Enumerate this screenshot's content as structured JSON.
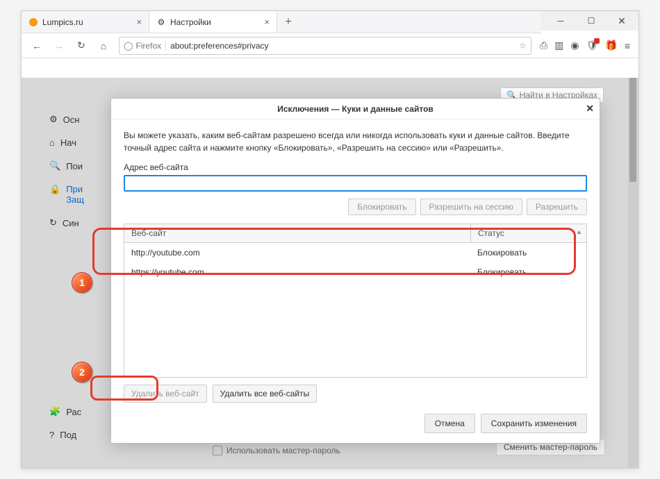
{
  "tabs": [
    {
      "favicon": "orange-circle",
      "label": "Lumpics.ru"
    },
    {
      "favicon": "gear",
      "label": "Настройки"
    }
  ],
  "urlbar": {
    "identity_label": "Firefox",
    "url": "about:preferences#privacy"
  },
  "sidebar": {
    "search_placeholder": "Найти в Настройках",
    "items": [
      {
        "icon": "gear",
        "label": "Осн"
      },
      {
        "icon": "home",
        "label": "Нач"
      },
      {
        "icon": "search",
        "label": "Пои"
      },
      {
        "icon": "lock",
        "label_line1": "При",
        "label_line2": "Защ"
      },
      {
        "icon": "sync",
        "label": "Син"
      }
    ],
    "bottom_items": [
      {
        "icon": "puzzle",
        "label": "Рас"
      },
      {
        "icon": "help",
        "label": "Под"
      }
    ]
  },
  "background_content": {
    "checkbox_label": "Использовать мастер-пароль",
    "master_pw_button": "Сменить мастер-пароль"
  },
  "modal": {
    "title": "Исключения — Куки и данные сайтов",
    "description": "Вы можете указать, каким веб-сайтам разрешено всегда или никогда использовать куки и данные сайтов. Введите точный адрес сайта и нажмите кнопку «Блокировать», «Разрешить на сессию» или «Разрешить».",
    "input_label": "Адрес веб-сайта",
    "input_value": "",
    "buttons": {
      "block": "Блокировать",
      "allow_session": "Разрешить на сессию",
      "allow": "Разрешить"
    },
    "table": {
      "col_site": "Веб-сайт",
      "col_status": "Статус",
      "rows": [
        {
          "site": "http://youtube.com",
          "status": "Блокировать"
        },
        {
          "site": "https://youtube.com",
          "status": "Блокировать"
        }
      ]
    },
    "remove_one": "Удалить веб-сайт",
    "remove_all": "Удалить все веб-сайты",
    "cancel": "Отмена",
    "save": "Сохранить изменения"
  },
  "annotations": {
    "badge1": "1",
    "badge2": "2"
  }
}
